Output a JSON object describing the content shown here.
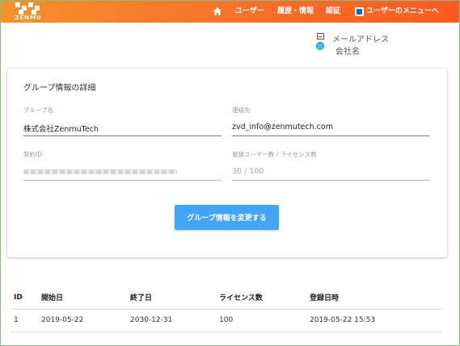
{
  "header": {
    "logo_text": "ZENMU",
    "nav": {
      "home_icon": "home-icon",
      "users": "ユーザー",
      "history": "履歴・情報",
      "auth": "認証",
      "user_menu": "ユーザーのメニューへ"
    },
    "colors": {
      "start": "#f7922a",
      "end": "#ff5a1f"
    }
  },
  "user_info": {
    "email": "メールアドレス",
    "company": "会社名"
  },
  "card": {
    "title": "グループ情報の詳細",
    "group_name_label": "グループ名",
    "group_name_value": "株式会社ZenmuTech",
    "contact_label": "連絡先",
    "contact_value": "zvd_info@zenmutech.com",
    "contract_id_label": "契約ID",
    "user_count_label": "登録ユーザー数 / ライセンス数",
    "user_count_value": "30 / 100",
    "change_button": "グループ情報を変更する",
    "accent": "#42a5f5"
  },
  "table": {
    "headers": [
      "ID",
      "開始日",
      "終了日",
      "ライセンス数",
      "登録日時"
    ],
    "rows": [
      [
        "1",
        "2019-05-22",
        "2030-12-31",
        "100",
        "2019-05-22 15:53"
      ]
    ]
  }
}
